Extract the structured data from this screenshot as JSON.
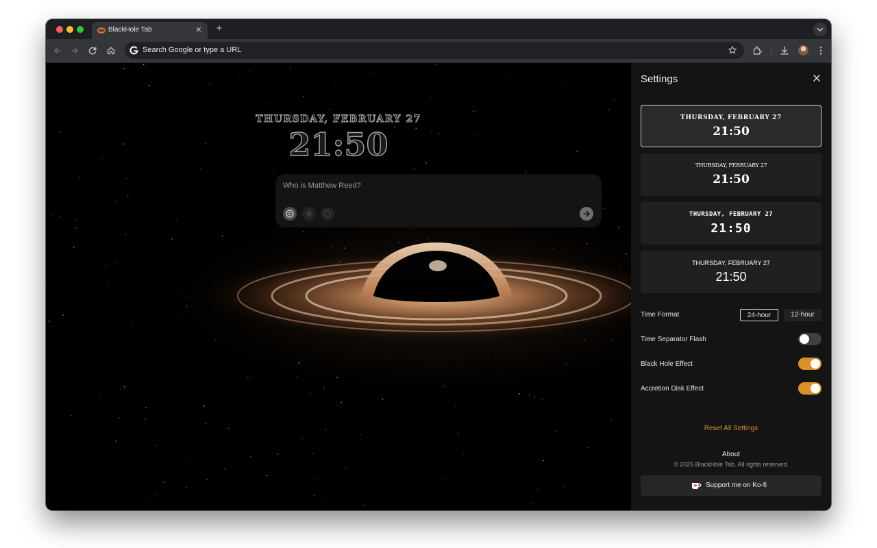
{
  "browser": {
    "tab": {
      "title": "BlackHole Tab",
      "close_icon": "close-icon"
    },
    "new_tab_icon": "plus-icon",
    "omnibox": {
      "placeholder": "Search Google or type a URL"
    }
  },
  "newtab": {
    "date": "THURSDAY, FEBRUARY 27",
    "time": "21:50",
    "search": {
      "placeholder": "Who is Matthew Reed?"
    }
  },
  "settings": {
    "title": "Settings",
    "clock_styles": [
      {
        "date": "THURSDAY, FEBRUARY 27",
        "time": "21:50",
        "selected": true
      },
      {
        "date": "THURSDAY, FEBRUARY 27",
        "time": "21:50",
        "selected": false
      },
      {
        "date": "THURSDAY, FEBRUARY 27",
        "time": "21:50",
        "selected": false
      },
      {
        "date": "THURSDAY, FEBRUARY 27",
        "time": "21:50",
        "selected": false
      }
    ],
    "time_format": {
      "label": "Time Format",
      "options": [
        "24-hour",
        "12-hour"
      ],
      "selected": "24-hour"
    },
    "toggles": [
      {
        "label": "Time Separator Flash",
        "on": false
      },
      {
        "label": "Black Hole Effect",
        "on": true
      },
      {
        "label": "Accretion Disk Effect",
        "on": true
      }
    ],
    "reset_label": "Reset All Settings",
    "about": {
      "heading": "About",
      "copyright": "© 2025 BlackHole Tab. All rights reserved."
    },
    "kofi_label": "Support me on Ko-fi"
  },
  "colors": {
    "accent": "#d9912b",
    "panel_bg": "#141414",
    "tab_bg": "#35363a"
  }
}
